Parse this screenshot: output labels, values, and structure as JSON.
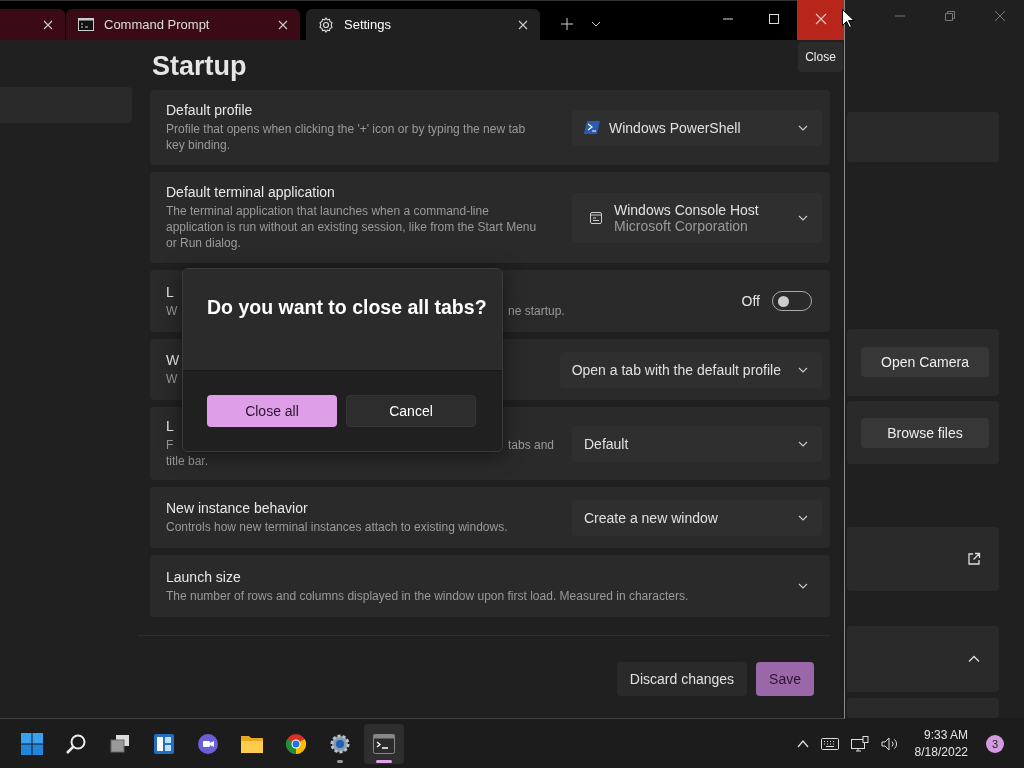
{
  "terminal_window": {
    "tabs": [
      {
        "kind": "partial",
        "selected": false
      },
      {
        "kind": "console",
        "label": "Command Prompt",
        "selected": false
      },
      {
        "kind": "settings",
        "label": "Settings",
        "selected": true
      }
    ],
    "close_tooltip": "Close",
    "page_title": "Startup",
    "rows": [
      {
        "kind": "dropdown",
        "title": "Default profile",
        "description": "Profile that opens when clicking the '+' icon or by typing the new tab key binding.",
        "value": "Windows PowerShell"
      },
      {
        "kind": "dropdown",
        "title": "Default terminal application",
        "description": "The terminal application that launches when a command-line application is run without an existing session, like from the Start Menu or Run dialog.",
        "value": "Windows Console Host",
        "value_detail": "Microsoft Corporation"
      },
      {
        "kind": "toggle",
        "title": "L",
        "description_fragments": [
          [
            "W",
            "ne startup."
          ]
        ],
        "state_label": "Off",
        "on": false
      },
      {
        "kind": "dropdown",
        "title": "W",
        "description_fragments": [
          [
            "W"
          ]
        ],
        "value": "Open a tab with the default profile"
      },
      {
        "kind": "dropdown",
        "title": "L",
        "description_fragments": [
          [
            "F",
            "tabs and"
          ],
          [
            "title bar."
          ]
        ],
        "value": "Default"
      },
      {
        "kind": "dropdown",
        "title": "New instance behavior",
        "description": "Controls how new terminal instances attach to existing windows.",
        "value": "Create a new window"
      },
      {
        "kind": "expander",
        "title": "Launch size",
        "description": "The number of rows and columns displayed in the window upon first load. Measured in characters.",
        "expanded": false
      }
    ],
    "footer_buttons": [
      {
        "label": "Discard changes",
        "kind": "secondary"
      },
      {
        "label": "Save",
        "kind": "primary"
      }
    ],
    "dialog": {
      "title": "Do you want to close all tabs?",
      "buttons": [
        {
          "label": "Close all",
          "kind": "primary"
        },
        {
          "label": "Cancel",
          "kind": "secondary"
        }
      ]
    }
  },
  "background_window": {
    "cards": [
      {
        "kind": "blank"
      },
      {
        "kind": "button",
        "button": "Open Camera"
      },
      {
        "kind": "button",
        "button": "Browse files"
      },
      {
        "kind": "link"
      },
      {
        "kind": "expander",
        "expanded": true
      },
      {
        "kind": "blank"
      }
    ]
  },
  "taskbar": {
    "apps": [
      {
        "kind": "start",
        "running": false,
        "selected": false
      },
      {
        "kind": "search",
        "running": false,
        "selected": false
      },
      {
        "kind": "taskview",
        "running": false,
        "selected": false
      },
      {
        "kind": "widgets",
        "running": false,
        "selected": false
      },
      {
        "kind": "chat",
        "running": false,
        "selected": false
      },
      {
        "kind": "folder",
        "running": false,
        "selected": false
      },
      {
        "kind": "browser",
        "running": false,
        "selected": false
      },
      {
        "kind": "settings",
        "running": true,
        "selected": false
      },
      {
        "kind": "terminal",
        "running": true,
        "selected": true
      }
    ],
    "time": "9:33 AM",
    "date": "8/18/2022",
    "notifications": "3"
  }
}
